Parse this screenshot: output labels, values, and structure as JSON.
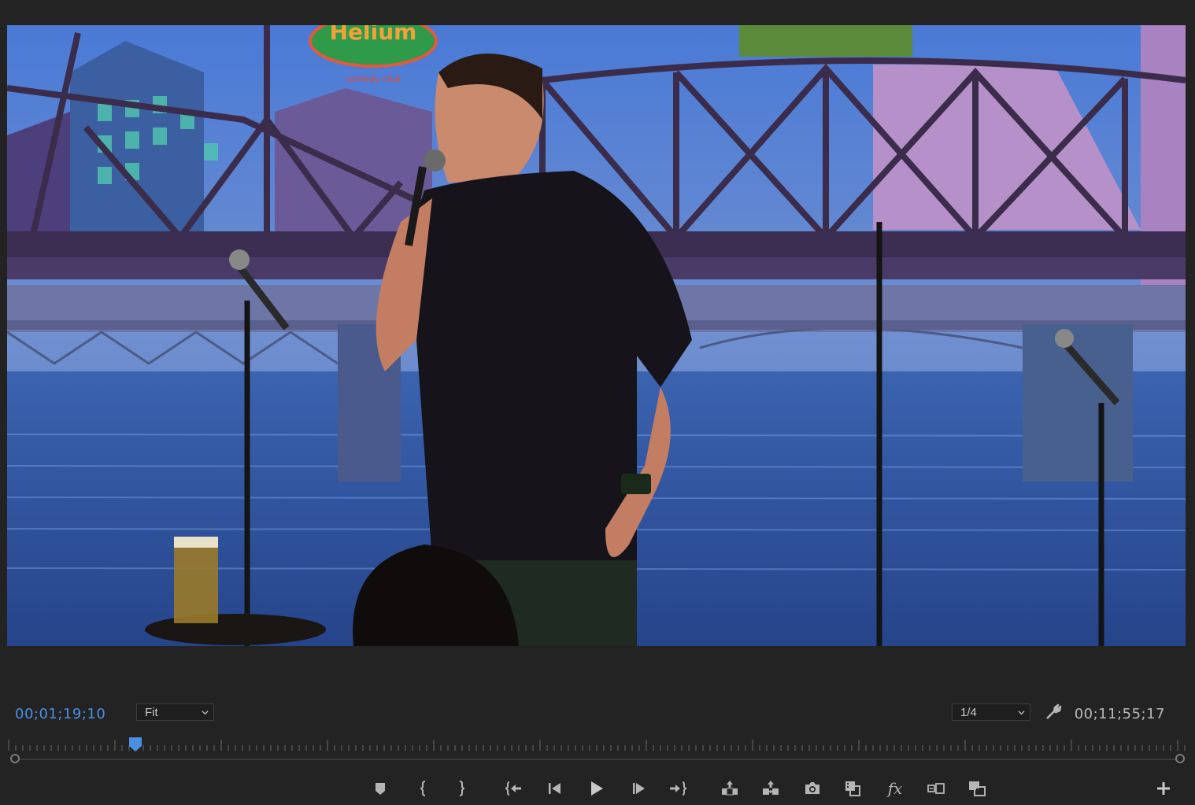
{
  "viewer": {
    "sign_text": "Helium",
    "sign_sub": "comedy club"
  },
  "timecode": {
    "current": "00;01;19;10",
    "total": "00;11;55;17"
  },
  "zoom": {
    "value": "Fit"
  },
  "resolution": {
    "value": "1/4"
  },
  "playhead": {
    "position": 0.11
  },
  "colors": {
    "accent": "#4a90e2",
    "panel_bg": "#232323",
    "icon": "#b5b5b5"
  },
  "transport": {
    "icons": [
      "add-marker-icon",
      "mark-in-icon",
      "mark-out-icon",
      "go-to-in-icon",
      "step-back-icon",
      "play-icon",
      "step-forward-icon",
      "go-to-out-icon",
      "lift-icon",
      "extract-icon",
      "export-frame-icon",
      "insert-icon",
      "fx-icon",
      "comparison-view-icon",
      "proxy-toggle-icon",
      "add-button-icon"
    ],
    "fx_label": "fx"
  }
}
